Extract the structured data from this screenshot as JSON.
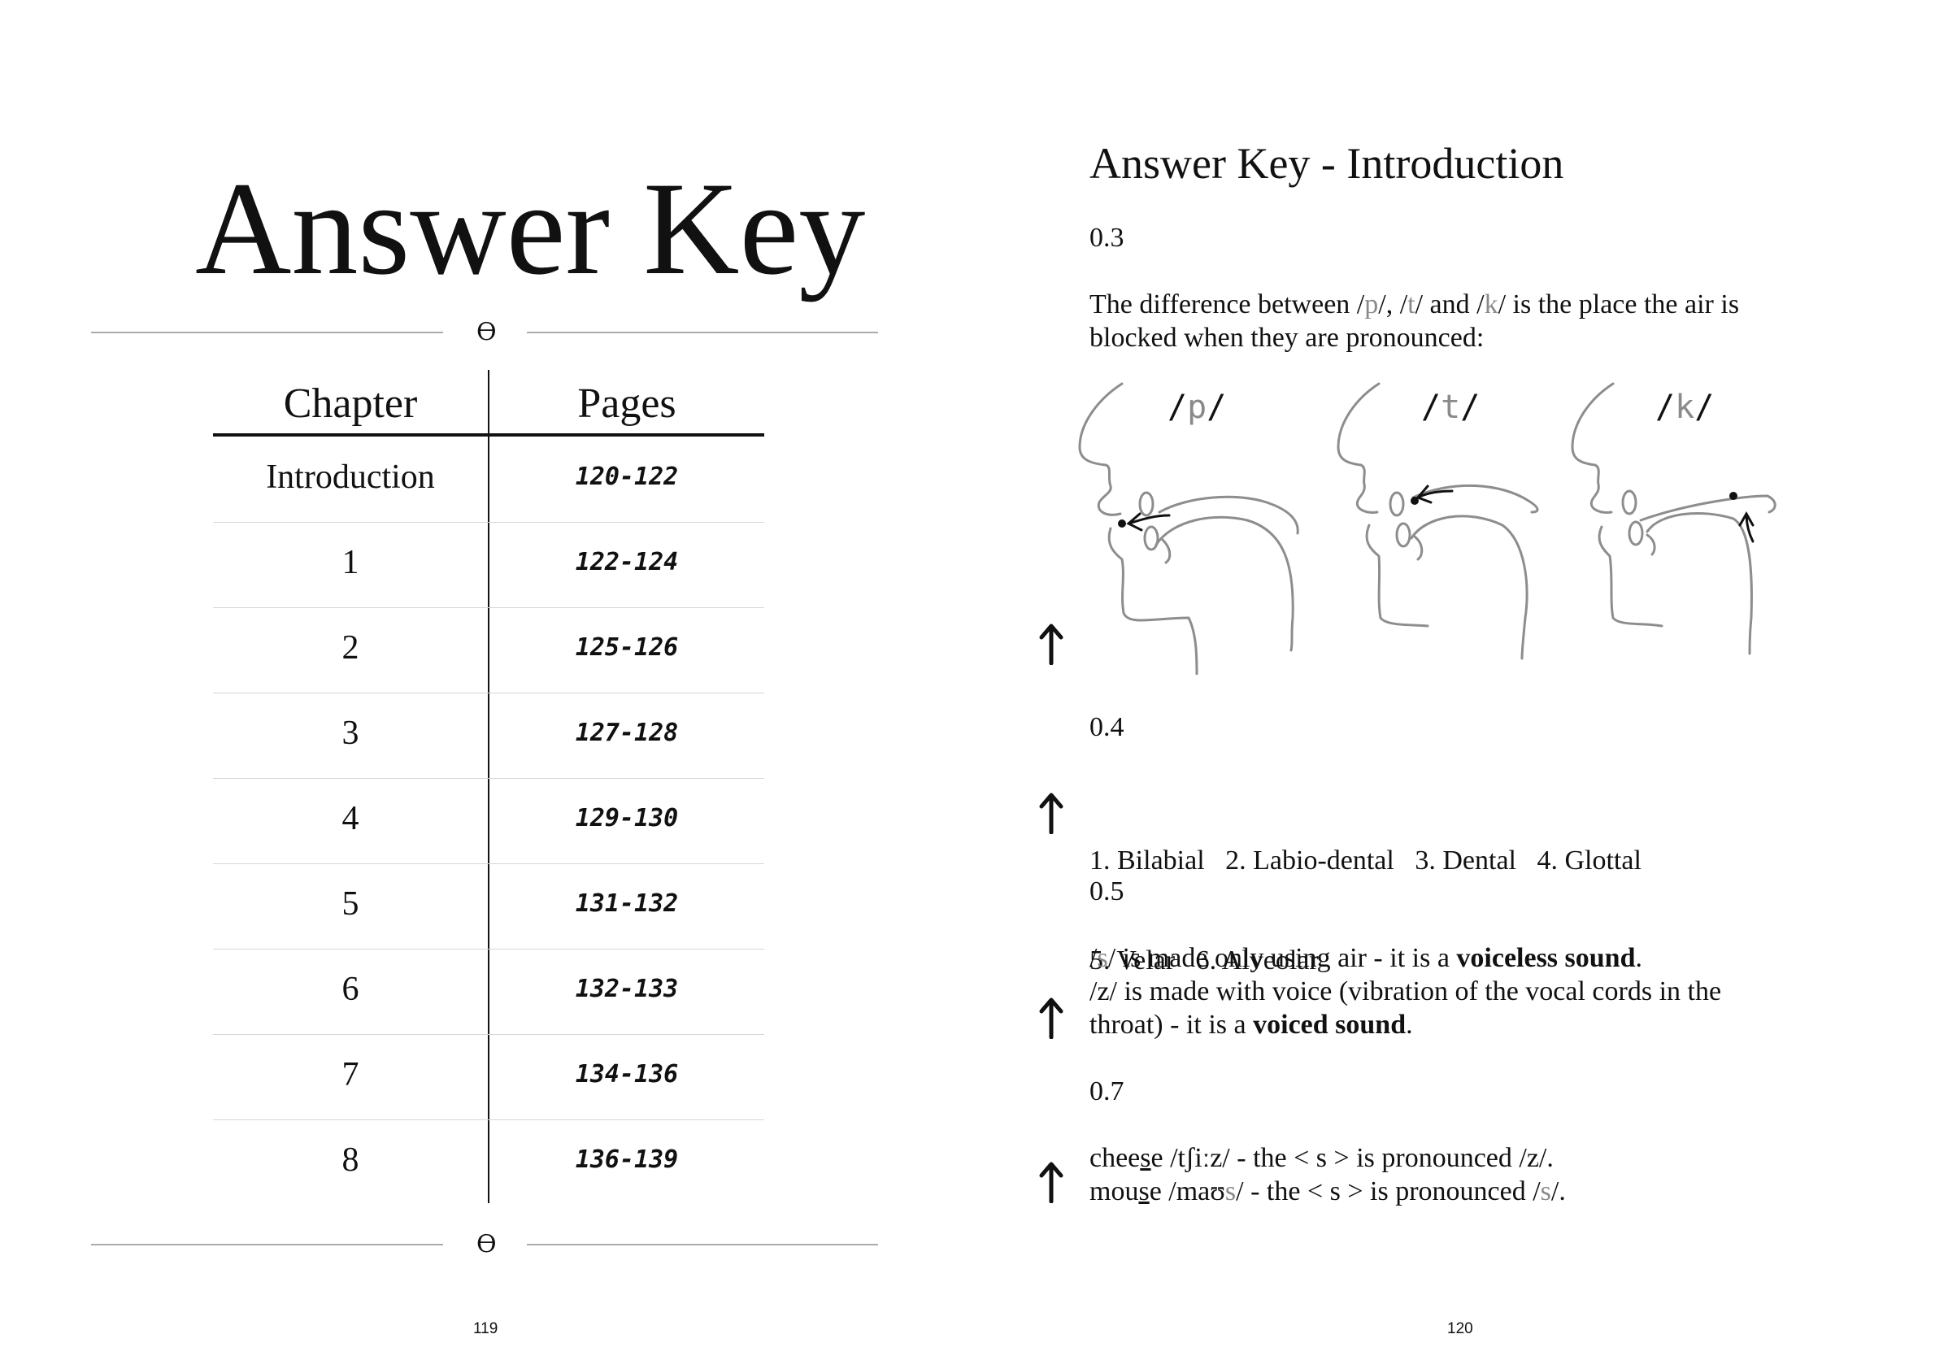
{
  "left_page": {
    "title": "Answer Key",
    "ornament": "ϴ",
    "table": {
      "headers": [
        "Chapter",
        "Pages"
      ],
      "rows": [
        {
          "chapter": "Introduction",
          "pages": "120-122"
        },
        {
          "chapter": "1",
          "pages": "122-124"
        },
        {
          "chapter": "2",
          "pages": "125-126"
        },
        {
          "chapter": "3",
          "pages": "127-128"
        },
        {
          "chapter": "4",
          "pages": "129-130"
        },
        {
          "chapter": "5",
          "pages": "131-132"
        },
        {
          "chapter": "6",
          "pages": "132-133"
        },
        {
          "chapter": "7",
          "pages": "134-136"
        },
        {
          "chapter": "8",
          "pages": "136-139"
        }
      ]
    },
    "page_number": "119"
  },
  "right_page": {
    "title": "Answer Key - Introduction",
    "s03": {
      "num": "0.3",
      "line1_a": "The difference between /",
      "line1_p": "p",
      "line1_b": "/, /",
      "line1_t": "t",
      "line1_c": "/ and /",
      "line1_k": "k",
      "line1_d": "/ is the place the air is",
      "line2": "blocked when they are pronounced:",
      "diagram_labels": [
        {
          "pre": "/",
          "sym": "p",
          "post": "/"
        },
        {
          "pre": "/",
          "sym": "t",
          "post": "/"
        },
        {
          "pre": "/",
          "sym": "k",
          "post": "/"
        }
      ]
    },
    "s04": {
      "num": "0.4",
      "line1": "1. Bilabial   2. Labio-dental   3. Dental   4. Glottal",
      "line2": "5. Velar   6. Alveolar"
    },
    "s05": {
      "num": "0.5",
      "l1_a": "/",
      "l1_s": "s",
      "l1_b": "/ is made only using air - it is a ",
      "l1_bold": "voiceless sound",
      "l1_end": ".",
      "l2": "/z/ is made with voice (vibration of the vocal cords in the",
      "l3_a": "throat) - it is a ",
      "l3_bold": "voiced sound",
      "l3_end": "."
    },
    "s07": {
      "num": "0.7",
      "l1_a": "chee",
      "l1_u": "s",
      "l1_b": "e /tʃiːz/ - the < s > is pronounced /z/.",
      "l2_a": "mou",
      "l2_u": "s",
      "l2_b": "e /maʊ",
      "l2_s": "s",
      "l2_c": "/ - the < s > is pronounced /",
      "l2_s2": "s",
      "l2_d": "/."
    },
    "page_number": "120"
  },
  "colors": {
    "ink": "#111111",
    "grey_symbol": "#8a8a8a",
    "rule": "#aaaaaa"
  },
  "icons": [
    "up-arrow-icon",
    "ornament-icon"
  ]
}
